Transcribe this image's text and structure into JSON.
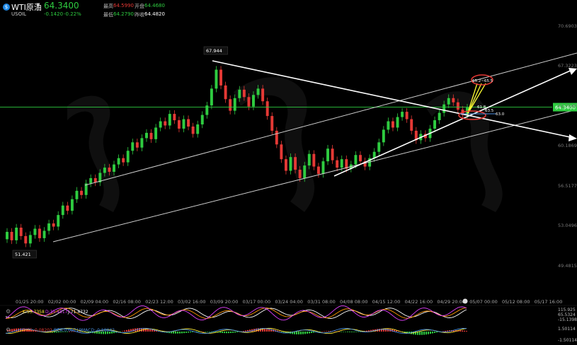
{
  "header": {
    "symbol": "WTI原油",
    "code": "USOIL",
    "price": "64.3400",
    "change": "-0.1420",
    "change_pct": "-0.22%",
    "high_label": "最高",
    "high_value": "64.5990",
    "open_label": "开盘",
    "open_value": "64.4680",
    "low_label": "最低",
    "low_value": "64.2790",
    "prev_label": "昨收",
    "prev_value": "64.4820"
  },
  "chart_data": {
    "type": "candlestick",
    "y_ticks": [
      "70.6903",
      "67.3223",
      "63.7540",
      "60.1869",
      "56.5177",
      "53.0496",
      "49.4815"
    ],
    "x_ticks": [
      "01/25 20:00",
      "02/02 00:00",
      "02/09 04:00",
      "02/16 08:00",
      "02/23 12:00",
      "03/02 16:00",
      "03/09 20:00",
      "03/17 00:00",
      "03/24 04:00",
      "03/31 08:00",
      "04/08 08:00",
      "04/15 12:00",
      "04/22 16:00",
      "04/29 20:00",
      "05/07 00:00",
      "05/12 08:00",
      "05/17 16:00"
    ],
    "ylim": [
      48.0,
      72.5
    ],
    "last_price_label": "64.3400",
    "last_price": 64.34,
    "annotations": {
      "high": {
        "label": "67.944",
        "value": 67.944,
        "x_label": "03/09 20:00"
      },
      "low": {
        "label": "51.421",
        "value": 51.421,
        "x_label": "01/25 20:00"
      },
      "target_top": "65.2~65.5",
      "level_618": "61.8",
      "level_635": "63.5",
      "level_630": "63.0"
    },
    "price_path": [
      [
        51.8,
        52.5
      ],
      [
        52.5,
        51.7
      ],
      [
        51.7,
        52.9
      ],
      [
        52.9,
        52.1
      ],
      [
        52.1,
        51.4
      ],
      [
        51.4,
        52.2
      ],
      [
        52.2,
        52.8
      ],
      [
        52.8,
        51.9
      ],
      [
        51.9,
        52.6
      ],
      [
        52.6,
        53.3
      ],
      [
        53.3,
        53.0
      ],
      [
        53.0,
        54.1
      ],
      [
        54.1,
        55.0
      ],
      [
        55.0,
        54.5
      ],
      [
        54.5,
        55.6
      ],
      [
        55.6,
        56.4
      ],
      [
        56.4,
        56.0
      ],
      [
        56.0,
        57.1
      ],
      [
        57.1,
        57.6
      ],
      [
        57.6,
        57.2
      ],
      [
        57.2,
        58.1
      ],
      [
        58.1,
        58.6
      ],
      [
        58.6,
        58.2
      ],
      [
        58.2,
        58.9
      ],
      [
        58.9,
        59.5
      ],
      [
        59.5,
        59.1
      ],
      [
        59.1,
        60.2
      ],
      [
        60.2,
        61.0
      ],
      [
        61.0,
        60.5
      ],
      [
        60.5,
        61.4
      ],
      [
        61.4,
        61.9
      ],
      [
        61.9,
        61.3
      ],
      [
        61.3,
        62.4
      ],
      [
        62.4,
        63.0
      ],
      [
        63.0,
        62.6
      ],
      [
        62.6,
        63.7
      ],
      [
        63.7,
        63.1
      ],
      [
        63.1,
        62.3
      ],
      [
        62.3,
        63.2
      ],
      [
        63.2,
        62.5
      ],
      [
        62.5,
        61.8
      ],
      [
        61.8,
        62.7
      ],
      [
        62.7,
        63.6
      ],
      [
        63.6,
        64.5
      ],
      [
        64.5,
        66.1
      ],
      [
        66.1,
        67.9
      ],
      [
        67.9,
        66.4
      ],
      [
        66.4,
        65.1
      ],
      [
        65.1,
        64.0
      ],
      [
        64.0,
        65.2
      ],
      [
        65.2,
        66.0
      ],
      [
        66.0,
        65.3
      ],
      [
        65.3,
        64.4
      ],
      [
        64.4,
        65.5
      ],
      [
        65.5,
        66.1
      ],
      [
        66.1,
        64.9
      ],
      [
        64.9,
        63.5
      ],
      [
        63.5,
        62.1
      ],
      [
        62.1,
        60.8
      ],
      [
        60.8,
        59.4
      ],
      [
        59.4,
        58.3
      ],
      [
        58.3,
        59.6
      ],
      [
        59.6,
        58.4
      ],
      [
        58.4,
        57.6
      ],
      [
        57.6,
        58.8
      ],
      [
        58.8,
        59.9
      ],
      [
        59.9,
        58.7
      ],
      [
        58.7,
        58.0
      ],
      [
        58.0,
        59.2
      ],
      [
        59.2,
        60.4
      ],
      [
        60.4,
        59.3
      ],
      [
        59.3,
        58.6
      ],
      [
        58.6,
        59.4
      ],
      [
        59.4,
        58.5
      ],
      [
        58.5,
        58.9
      ],
      [
        58.9,
        59.8
      ],
      [
        59.8,
        59.2
      ],
      [
        59.2,
        58.7
      ],
      [
        58.7,
        59.5
      ],
      [
        59.5,
        60.1
      ],
      [
        60.1,
        61.0
      ],
      [
        61.0,
        62.2
      ],
      [
        62.2,
        63.0
      ],
      [
        63.0,
        62.4
      ],
      [
        62.4,
        63.4
      ],
      [
        63.4,
        63.9
      ],
      [
        63.9,
        63.2
      ],
      [
        63.2,
        62.1
      ],
      [
        62.1,
        61.2
      ],
      [
        61.2,
        61.8
      ],
      [
        61.8,
        61.4
      ],
      [
        61.4,
        62.3
      ],
      [
        62.3,
        63.1
      ],
      [
        63.1,
        63.8
      ],
      [
        63.8,
        64.6
      ],
      [
        64.6,
        65.2
      ],
      [
        65.2,
        64.8
      ],
      [
        64.8,
        64.1
      ],
      [
        64.1,
        63.6
      ],
      [
        63.6,
        64.3
      ]
    ],
    "indicators": {
      "kdj": {
        "k_label": "K:53.7358",
        "d_label": "D:35.4817",
        "j_label": "J:71.4732"
      },
      "macd": {
        "diff_label": "DIFF:-0.08202",
        "dea_label": "DEA:0.00719",
        "macd_label": "MACD:-0.18042"
      },
      "kdj_axis": [
        "115.925",
        "65.5324",
        "-15.1398"
      ],
      "macd_axis": [
        "1.50114",
        "-1.50114"
      ]
    },
    "colors": {
      "up": "#2ecc40",
      "down": "#e53935",
      "trend": "#ffffff",
      "channel": "#cfcfcf",
      "last_line": "#2ecc40",
      "fan": "#ffff33"
    }
  }
}
